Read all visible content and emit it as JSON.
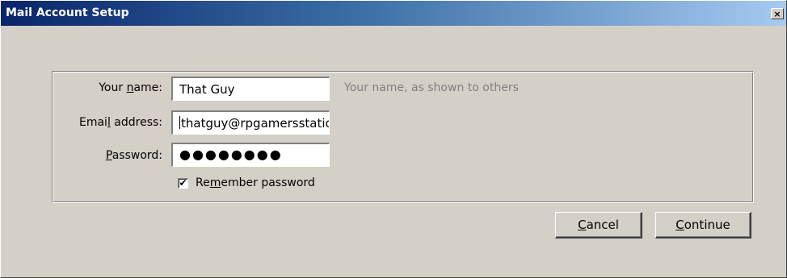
{
  "window": {
    "title": "Mail Account Setup",
    "close_glyph": "×"
  },
  "form": {
    "name_label_pre": "Your ",
    "name_label_u": "n",
    "name_label_post": "ame:",
    "name_value": "That Guy",
    "name_hint": "Your name, as shown to others",
    "email_label_pre": "Emai",
    "email_label_u": "l",
    "email_label_post": " address:",
    "email_value": "thatguy@rpgamersstatio",
    "password_label_u": "P",
    "password_label_post": "assword:",
    "password_value": "●●●●●●●●",
    "remember_label_pre": "Re",
    "remember_label_u": "m",
    "remember_label_post": "ember password",
    "remember_checked": true,
    "check_glyph": "✔"
  },
  "buttons": {
    "cancel_u": "C",
    "cancel_post": "ancel",
    "continue_u": "C",
    "continue_post": "ontinue"
  }
}
